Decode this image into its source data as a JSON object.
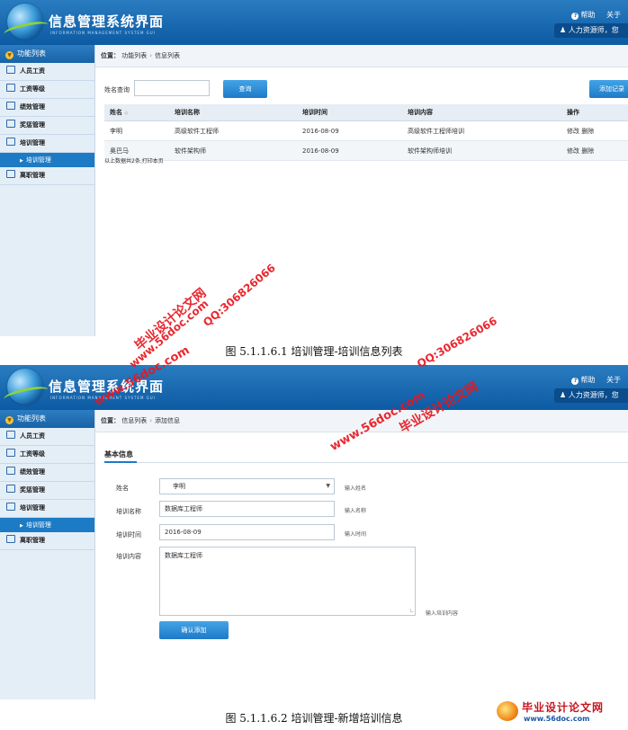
{
  "app": {
    "title": "信息管理系统界面",
    "subtitle": "INFORMATION MANAGEMENT SYSTEM GUI",
    "help_label": "帮助",
    "about_label": "关于",
    "user_label": "人力资源师，您"
  },
  "sidebar": {
    "header": "功能列表",
    "items": [
      {
        "label": "人员工资"
      },
      {
        "label": "工资等级"
      },
      {
        "label": "绩效管理"
      },
      {
        "label": "奖惩管理"
      },
      {
        "label": "培训管理"
      },
      {
        "label": "离职管理"
      }
    ],
    "active_sub": "培训管理"
  },
  "screen1": {
    "breadcrumb": {
      "prefix": "位置：",
      "items": [
        "功能列表",
        "信息列表"
      ]
    },
    "search": {
      "label": "姓名查询",
      "value": "",
      "button": "查询"
    },
    "add_button": "添加记录",
    "table": {
      "headers": [
        "姓名",
        "培训名称",
        "培训时间",
        "培训内容",
        "操作"
      ],
      "rows": [
        {
          "name": "李明",
          "training": "高级软件工程师",
          "date": "2016-08-09",
          "content": "高级软件工程师培训",
          "edit": "修改",
          "delete": "删除"
        },
        {
          "name": "奥巴马",
          "training": "软件架构师",
          "date": "2016-08-09",
          "content": "软件架构师培训",
          "edit": "修改",
          "delete": "删除"
        }
      ]
    },
    "summary": "以上数据共2条,打印本页"
  },
  "caption1": "图  5.1.1.6.1  培训管理-培训信息列表",
  "screen2": {
    "breadcrumb": {
      "prefix": "位置：",
      "items": [
        "信息列表",
        "添加信息"
      ]
    },
    "section_title": "基本信息",
    "form": {
      "name": {
        "label": "姓名",
        "value": "李明",
        "hint": "输入姓名"
      },
      "training": {
        "label": "培训名称",
        "value": "数据库工程师",
        "hint": "输入名称"
      },
      "date": {
        "label": "培训时间",
        "value": "2016-08-09",
        "hint": "输入时间"
      },
      "content": {
        "label": "培训内容",
        "value": "数据库工程师",
        "hint": "输入培训内容"
      }
    },
    "submit": "确认添加"
  },
  "caption2": "图  5.1.1.6.2  培训管理-新增培训信息",
  "watermarks": {
    "text1": "毕业设计论文网",
    "text2": "www.56doc.com",
    "text3": "QQ:306826066"
  },
  "footer_logo": {
    "text": "毕业设计论文网",
    "url": "www.56doc.com"
  },
  "colors": {
    "header_blue": "#1b66aa",
    "accent": "#1e7ac8",
    "watermark_red": "#e8161f"
  }
}
